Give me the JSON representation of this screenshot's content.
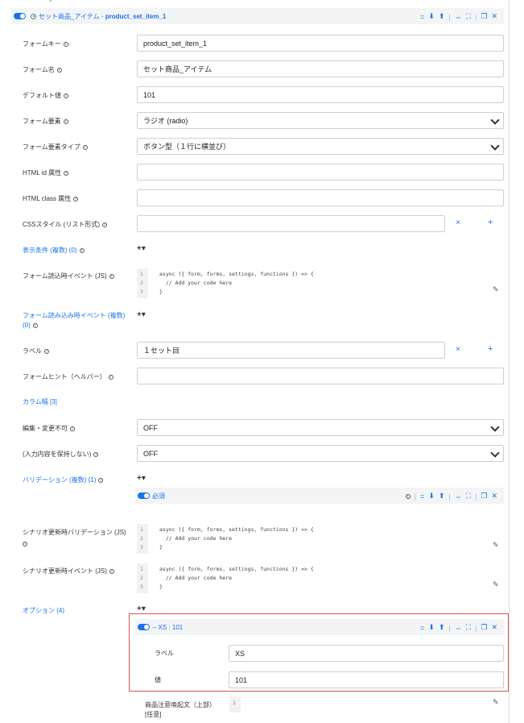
{
  "top_add": "+",
  "item_header": {
    "title_prefix": "セット商品_アイテム - ",
    "title_key": "product_set_item_1",
    "icons": [
      "equals-icon",
      "arrow-down-icon",
      "arrow-up-icon",
      "expand-icon",
      "fullscreen-icon",
      "copy-icon",
      "close-icon"
    ]
  },
  "fields": {
    "form_key": {
      "label": "フォームキー",
      "value": "product_set_item_1"
    },
    "form_name": {
      "label": "フォーム名",
      "value": "セット商品_アイテム"
    },
    "default_value": {
      "label": "デフォルト値",
      "value": "101"
    },
    "form_element": {
      "label": "フォーム要素",
      "value": "ラジオ (radio)"
    },
    "form_element_type": {
      "label": "フォーム要素タイプ",
      "value": "ボタン型（１行に横並び）"
    },
    "html_id": {
      "label": "HTML id 属性",
      "value": ""
    },
    "html_class": {
      "label": "HTML class 属性",
      "value": ""
    },
    "css_style": {
      "label": "CSSスタイル (リスト形式)",
      "value": ""
    },
    "display_condition": {
      "label": "表示条件 (複数) (0)"
    },
    "form_load_event": {
      "label": "フォーム読込時イベント (JS)"
    },
    "form_loaded_event": {
      "label": "フォーム読み込み時イベント (複数)",
      "label2": "(0)"
    },
    "label": {
      "label": "ラベル",
      "value": "１セット目"
    },
    "form_hint": {
      "label": "フォームヒント（ヘルパー）",
      "value": ""
    },
    "column_width": {
      "label": "カラム幅 [3]"
    },
    "readonly": {
      "label": "編集・変更不可",
      "value": "OFF"
    },
    "no_keep": {
      "label": "(入力内容を保持しない)",
      "value": "OFF"
    },
    "validation": {
      "label": "バリデーション (複数) (1)"
    },
    "scenario_validation": {
      "label": "シナリオ更新時バリデーション (JS)"
    },
    "scenario_event": {
      "label": "シナリオ更新時イベント (JS)"
    },
    "options": {
      "label": "オプション (4)"
    },
    "note": {
      "label": "商品注意喚起文（上部）",
      "label2": "[任意]"
    }
  },
  "code": {
    "line1": "async ({ form, forms, settings, functions }) => {",
    "line2": "  // Add your code here",
    "line3": "}",
    "nums": [
      "1",
      "2",
      "3"
    ]
  },
  "validation_item": {
    "title": "必須"
  },
  "option_item": {
    "title": "-- XS : 101",
    "label_label": "ラベル",
    "label_value": "XS",
    "value_label": "値",
    "value_value": "101"
  },
  "buttons": {
    "remove": "×",
    "add": "+",
    "add_menu": "+▾"
  },
  "note_line": "1",
  "colors": {
    "accent": "#1a73e8",
    "highlight": "#d9534f"
  }
}
